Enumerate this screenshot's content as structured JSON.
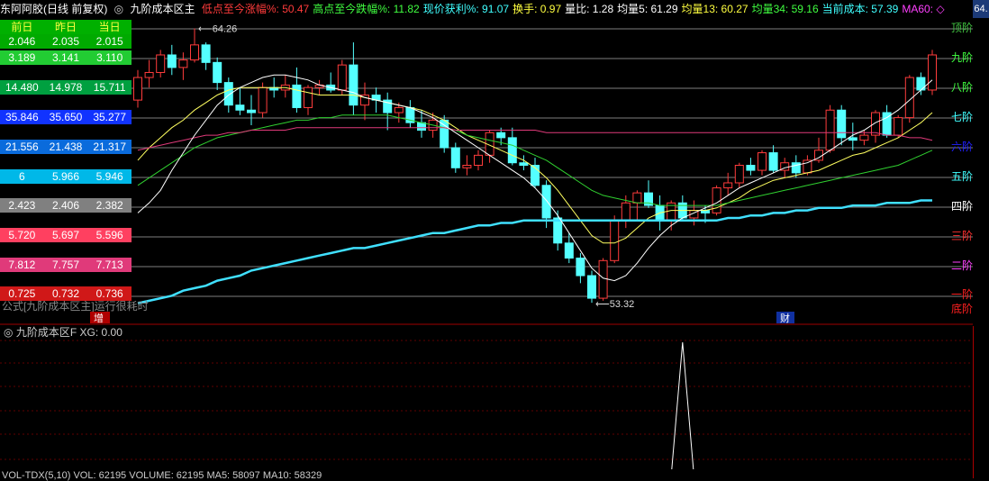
{
  "header": {
    "stock": "东阿阿胶(日线 前复权)",
    "indicator": "九阶成本区主",
    "items": [
      {
        "label": "低点至今涨幅%: 50.47",
        "color": "#ff3b3b"
      },
      {
        "label": "高点至今跌幅%: 11.82",
        "color": "#40ff40"
      },
      {
        "label": "现价获利%: 91.07",
        "color": "#40ffff"
      },
      {
        "label": "换手: 0.97",
        "color": "#ffff40"
      },
      {
        "label": "量比: 1.28",
        "color": "#ffffff"
      },
      {
        "label": "均量5: 61.29",
        "color": "#ffffff"
      },
      {
        "label": "均量13: 60.27",
        "color": "#ffff40"
      },
      {
        "label": "均量34: 59.16",
        "color": "#40ff40"
      },
      {
        "label": "当前成本: 57.39",
        "color": "#40ffff"
      },
      {
        "label": "MA60: ◇",
        "color": "#ff40ff"
      }
    ]
  },
  "cost_panel": {
    "headers": [
      "前日",
      "昨日",
      "当日"
    ],
    "rows": [
      {
        "values": [
          "2.046",
          "2.035",
          "2.015"
        ],
        "bg": "#00aa00"
      },
      {
        "values": [
          "3.189",
          "3.141",
          "3.110"
        ],
        "bg": "#22cc33"
      },
      {
        "values": [
          "14.480",
          "14.978",
          "15.711"
        ],
        "bg": "#00a040"
      },
      {
        "values": [
          "35.846",
          "35.650",
          "35.277"
        ],
        "bg": "#1133ff"
      },
      {
        "values": [
          "21.556",
          "21.438",
          "21.317"
        ],
        "bg": "#0a6bdc"
      },
      {
        "values": [
          "6",
          "5.966",
          "5.946"
        ],
        "bg": "#00b8e8"
      },
      {
        "values": [
          "2.423",
          "2.406",
          "2.382"
        ],
        "bg": "#808080"
      },
      {
        "values": [
          "5.720",
          "5.697",
          "5.596"
        ],
        "bg": "#ff4060"
      },
      {
        "values": [
          "7.812",
          "7.757",
          "7.713"
        ],
        "bg": "#e03a7a"
      },
      {
        "values": [
          "0.725",
          "0.732",
          "0.736"
        ],
        "bg": "#d01818"
      }
    ]
  },
  "levels": [
    {
      "label": "顶阶",
      "color": "#40c040"
    },
    {
      "label": "九阶",
      "color": "#40ff40"
    },
    {
      "label": "八阶",
      "color": "#40ff40"
    },
    {
      "label": "七阶",
      "color": "#40ffff"
    },
    {
      "label": "六阶",
      "color": "#2020ff"
    },
    {
      "label": "五阶",
      "color": "#40ffff"
    },
    {
      "label": "四阶",
      "color": "#ffffff"
    },
    {
      "label": "三阶",
      "color": "#ff3030"
    },
    {
      "label": "二阶",
      "color": "#ff40ff"
    },
    {
      "label": "一阶",
      "color": "#ff2020"
    },
    {
      "label": "底阶",
      "color": "#ff2020"
    }
  ],
  "annotations": {
    "high": "64.26",
    "low": "53.32",
    "formula_note": "公式[九阶成本区主]运行很耗时",
    "marker_zeng": "增",
    "marker_cai": "财"
  },
  "sub_chart": {
    "title": "九阶成本区F",
    "xg": "XG: 0.00"
  },
  "right_axis": {
    "top_value": "64."
  },
  "bottom": {
    "text": "VOL-TDX(5,10) VOL: 62195 VOLUME: 62195 MA5: 58097 MA10: 58329"
  },
  "chart_data": {
    "type": "candlestick",
    "candles": [
      [
        61.4,
        62.6,
        61.1,
        62.3
      ],
      [
        62.3,
        63.0,
        61.9,
        62.5
      ],
      [
        62.5,
        63.4,
        62.3,
        63.2
      ],
      [
        63.2,
        63.6,
        62.4,
        62.7
      ],
      [
        62.7,
        63.3,
        62.2,
        63.0
      ],
      [
        63.0,
        64.26,
        62.9,
        63.6
      ],
      [
        63.6,
        63.7,
        62.6,
        62.9
      ],
      [
        62.9,
        63.1,
        61.8,
        62.1
      ],
      [
        62.1,
        62.3,
        60.9,
        61.2
      ],
      [
        61.2,
        61.9,
        60.8,
        61.0
      ],
      [
        61.0,
        61.6,
        60.4,
        60.9
      ],
      [
        60.9,
        62.1,
        60.7,
        61.9
      ],
      [
        61.9,
        62.3,
        61.5,
        61.8
      ],
      [
        61.8,
        62.4,
        61.5,
        62.0
      ],
      [
        62.0,
        62.7,
        60.9,
        61.1
      ],
      [
        61.1,
        62.0,
        60.8,
        61.9
      ],
      [
        61.9,
        62.2,
        61.6,
        62.0
      ],
      [
        62.0,
        62.5,
        61.7,
        61.8
      ],
      [
        61.8,
        63.0,
        61.6,
        62.8
      ],
      [
        62.8,
        63.7,
        60.8,
        61.2
      ],
      [
        61.2,
        62.1,
        60.6,
        61.6
      ],
      [
        61.6,
        61.9,
        60.9,
        61.4
      ],
      [
        61.4,
        61.7,
        60.2,
        60.9
      ],
      [
        60.9,
        61.3,
        60.5,
        61.1
      ],
      [
        61.1,
        61.4,
        60.3,
        60.5
      ],
      [
        60.5,
        61.0,
        59.9,
        60.2
      ],
      [
        60.2,
        60.9,
        59.9,
        60.6
      ],
      [
        60.6,
        60.8,
        59.3,
        59.5
      ],
      [
        59.5,
        59.7,
        58.5,
        58.7
      ],
      [
        58.7,
        59.2,
        58.4,
        58.8
      ],
      [
        58.8,
        59.4,
        58.6,
        59.2
      ],
      [
        59.2,
        60.2,
        58.9,
        60.1
      ],
      [
        60.1,
        60.3,
        59.6,
        59.9
      ],
      [
        59.9,
        60.3,
        58.8,
        58.9
      ],
      [
        58.9,
        59.2,
        58.6,
        58.8
      ],
      [
        58.8,
        59.1,
        57.9,
        58.0
      ],
      [
        58.0,
        58.2,
        56.3,
        56.7
      ],
      [
        56.7,
        57.0,
        55.4,
        55.7
      ],
      [
        55.7,
        56.1,
        54.9,
        55.1
      ],
      [
        55.1,
        55.3,
        54.1,
        54.4
      ],
      [
        54.4,
        54.6,
        53.32,
        53.5
      ],
      [
        53.5,
        55.1,
        53.4,
        55.0
      ],
      [
        55.0,
        56.8,
        54.9,
        56.6
      ],
      [
        56.6,
        57.6,
        56.3,
        57.3
      ],
      [
        57.3,
        57.8,
        56.6,
        57.7
      ],
      [
        57.7,
        58.2,
        57.1,
        57.2
      ],
      [
        57.2,
        57.6,
        56.2,
        56.6
      ],
      [
        56.6,
        57.4,
        56.2,
        57.3
      ],
      [
        57.3,
        57.6,
        56.6,
        56.7
      ],
      [
        56.7,
        57.4,
        56.4,
        57.0
      ],
      [
        57.0,
        57.2,
        56.5,
        56.9
      ],
      [
        56.9,
        58.0,
        56.8,
        57.9
      ],
      [
        57.9,
        58.5,
        57.6,
        58.1
      ],
      [
        58.1,
        58.9,
        57.9,
        58.8
      ],
      [
        58.8,
        59.1,
        58.4,
        58.6
      ],
      [
        58.6,
        59.4,
        58.4,
        59.3
      ],
      [
        59.3,
        59.6,
        58.5,
        58.6
      ],
      [
        58.6,
        59.1,
        58.3,
        58.9
      ],
      [
        58.9,
        59.2,
        58.3,
        58.5
      ],
      [
        58.5,
        59.2,
        58.4,
        59.0
      ],
      [
        59.0,
        59.9,
        58.9,
        59.4
      ],
      [
        59.4,
        61.2,
        59.3,
        61.0
      ],
      [
        61.0,
        61.2,
        59.6,
        59.9
      ],
      [
        59.9,
        60.5,
        59.4,
        59.8
      ],
      [
        59.8,
        60.2,
        59.6,
        60.0
      ],
      [
        60.0,
        61.0,
        59.7,
        60.9
      ],
      [
        60.9,
        61.2,
        59.9,
        60.0
      ],
      [
        60.0,
        60.8,
        59.9,
        60.7
      ],
      [
        60.7,
        62.4,
        60.5,
        62.3
      ],
      [
        62.3,
        62.5,
        61.6,
        61.8
      ],
      [
        61.8,
        63.4,
        61.6,
        63.2
      ]
    ],
    "ma_series": [
      {
        "values": [
          59.0,
          59.5,
          59.9,
          60.3,
          60.6,
          61.0,
          61.3,
          61.6,
          61.8,
          61.9,
          61.9,
          61.9,
          61.9,
          61.9,
          61.8,
          61.7,
          61.6,
          61.6,
          61.6,
          61.6,
          61.5,
          61.4,
          61.3,
          61.2,
          61.1,
          61.0,
          60.8,
          60.6,
          60.3,
          60.0,
          59.8,
          59.6,
          59.4,
          59.2,
          59.0,
          58.7,
          58.3,
          57.8,
          57.2,
          56.6,
          56.0,
          55.7,
          55.7,
          55.9,
          56.3,
          56.7,
          56.9,
          57.0,
          57.0,
          57.0,
          57.0,
          57.1,
          57.3,
          57.5,
          57.8,
          58.0,
          58.2,
          58.3,
          58.4,
          58.5,
          58.6,
          58.8,
          59.0,
          59.2,
          59.3,
          59.5,
          59.7,
          59.9,
          60.2,
          60.5,
          60.9
        ],
        "color": "#ffff60"
      },
      {
        "values": [
          58.0,
          58.3,
          58.6,
          58.9,
          59.2,
          59.5,
          59.7,
          59.9,
          60.0,
          60.1,
          60.2,
          60.3,
          60.4,
          60.5,
          60.6,
          60.6,
          60.7,
          60.7,
          60.8,
          60.8,
          60.8,
          60.8,
          60.8,
          60.7,
          60.6,
          60.5,
          60.4,
          60.3,
          60.2,
          60.0,
          59.9,
          59.8,
          59.7,
          59.6,
          59.4,
          59.2,
          59.0,
          58.7,
          58.4,
          58.1,
          57.8,
          57.6,
          57.5,
          57.4,
          57.3,
          57.3,
          57.2,
          57.2,
          57.2,
          57.2,
          57.2,
          57.2,
          57.3,
          57.4,
          57.5,
          57.6,
          57.7,
          57.8,
          57.9,
          58.0,
          58.1,
          58.2,
          58.3,
          58.4,
          58.5,
          58.6,
          58.7,
          58.8,
          59.0,
          59.2,
          59.4
        ],
        "color": "#30d030"
      },
      {
        "values": [
          59.4,
          59.5,
          59.6,
          59.7,
          59.8,
          59.9,
          60.0,
          60.0,
          60.1,
          60.1,
          60.2,
          60.2,
          60.2,
          60.2,
          60.3,
          60.3,
          60.3,
          60.3,
          60.3,
          60.3,
          60.3,
          60.3,
          60.3,
          60.3,
          60.3,
          60.3,
          60.3,
          60.3,
          60.2,
          60.2,
          60.2,
          60.2,
          60.2,
          60.2,
          60.2,
          60.2,
          60.1,
          60.1,
          60.1,
          60.1,
          60.1,
          60.1,
          60.1,
          60.1,
          60.1,
          60.1,
          60.1,
          60.1,
          60.1,
          60.1,
          60.1,
          60.1,
          60.1,
          60.1,
          60.1,
          60.1,
          60.1,
          60.1,
          60.1,
          60.1,
          60.1,
          60.1,
          60.1,
          60.1,
          60.1,
          60.1,
          60.0,
          60.0,
          59.9,
          59.9,
          59.8
        ],
        "color": "#e03a7a"
      },
      {
        "values": [
          53.3,
          53.4,
          53.5,
          53.6,
          53.8,
          53.9,
          54.0,
          54.2,
          54.3,
          54.4,
          54.6,
          54.7,
          54.8,
          54.9,
          55.0,
          55.1,
          55.2,
          55.3,
          55.4,
          55.5,
          55.5,
          55.6,
          55.7,
          55.8,
          55.9,
          56.0,
          56.1,
          56.1,
          56.2,
          56.3,
          56.4,
          56.4,
          56.5,
          56.5,
          56.6,
          56.6,
          56.6,
          56.6,
          56.6,
          56.6,
          56.6,
          56.6,
          56.6,
          56.6,
          56.6,
          56.6,
          56.6,
          56.6,
          56.6,
          56.6,
          56.6,
          56.6,
          56.7,
          56.7,
          56.8,
          56.8,
          56.9,
          56.9,
          57.0,
          57.0,
          57.1,
          57.1,
          57.1,
          57.2,
          57.2,
          57.2,
          57.3,
          57.3,
          57.3,
          57.4,
          57.4
        ],
        "color": "#40e0ff"
      },
      {
        "values": [
          56.9,
          57.3,
          57.8,
          58.6,
          59.3,
          60.0,
          60.6,
          61.2,
          61.6,
          61.9,
          62.1,
          62.3,
          62.4,
          62.4,
          62.3,
          62.2,
          62.0,
          61.9,
          61.8,
          61.7,
          61.5,
          61.4,
          61.3,
          61.2,
          61.1,
          60.9,
          60.7,
          60.4,
          60.1,
          59.8,
          59.5,
          59.2,
          58.9,
          58.6,
          58.3,
          57.9,
          57.4,
          56.8,
          56.1,
          55.4,
          54.7,
          54.3,
          54.2,
          54.4,
          54.9,
          55.5,
          56.0,
          56.4,
          56.7,
          56.9,
          57.1,
          57.3,
          57.6,
          57.9,
          58.1,
          58.3,
          58.5,
          58.7,
          58.8,
          58.9,
          59.1,
          59.4,
          59.7,
          60.0,
          60.2,
          60.5,
          60.7,
          61.0,
          61.4,
          61.8,
          62.2
        ],
        "color": "#ffffff"
      }
    ],
    "xg_signal": {
      "index": 48,
      "value": 1
    },
    "ylim": [
      53.0,
      64.6
    ]
  }
}
